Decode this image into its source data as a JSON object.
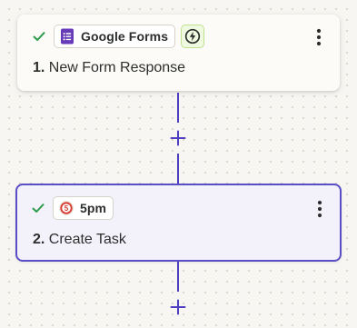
{
  "steps": [
    {
      "app_name": "Google Forms",
      "number": "1.",
      "title": "New Form Response",
      "icons": [
        "check-icon",
        "google-forms-icon",
        "lightning-icon",
        "more-vertical-icon"
      ]
    },
    {
      "app_name": "5pm",
      "number": "2.",
      "title": "Create Task",
      "icons": [
        "check-icon",
        "5pm-logo-icon",
        "more-vertical-icon"
      ]
    }
  ],
  "connectors": {
    "icon": "plus-icon"
  },
  "colors": {
    "accent": "#4d3fbf",
    "selected_border": "#5a4ec7",
    "check": "#2f9a4a",
    "google_forms": "#673ab7",
    "trigger_badge_bg": "#f0fae1",
    "fivepm_red": "#d7342a"
  }
}
